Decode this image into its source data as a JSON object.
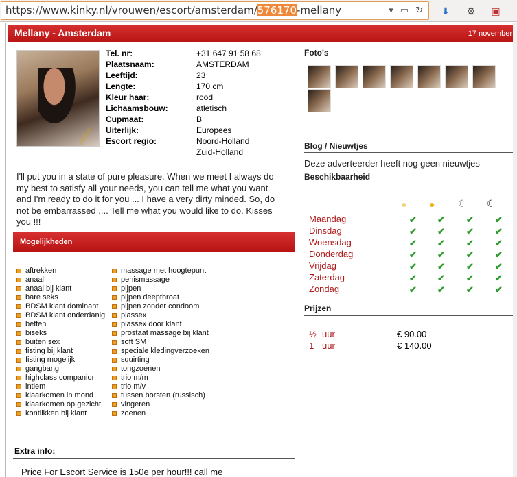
{
  "browser": {
    "url_prefix": "https://www.kinky.nl/vrouwen/escort/amsterdam/",
    "url_highlight": "576170",
    "url_suffix": "-mellany"
  },
  "header": {
    "title": "Mellany - Amsterdam",
    "date": "17 november"
  },
  "profile": {
    "rows": [
      {
        "label": "Tel. nr:",
        "value": "+31 647 91 58 68"
      },
      {
        "label": "Plaatsnaam:",
        "value": "AMSTERDAM"
      },
      {
        "label": "Leeftijd:",
        "value": "23"
      },
      {
        "label": "Lengte:",
        "value": "170 cm"
      },
      {
        "label": "Kleur haar:",
        "value": "rood"
      },
      {
        "label": "Lichaamsbouw:",
        "value": "atletisch"
      },
      {
        "label": "Cupmaat:",
        "value": "B"
      },
      {
        "label": "Uiterlijk:",
        "value": "Europees"
      },
      {
        "label": "Escort regio:",
        "value": "Noord-Holland"
      },
      {
        "label": "",
        "value": "Zuid-Holland"
      }
    ],
    "description": "I'll put you in a state of pure pleasure. When we meet I always do my best to satisfy all your needs, you can tell me what you want and I'm ready to do it for you ... I have a very dirty minded. So, do not be embarrassed .... Tell me what you would like to do. Kisses you !!!"
  },
  "mogelijkheden": {
    "title": "Mogelijkheden",
    "col1": [
      "aftrekken",
      "anaal",
      "anaal bij klant",
      "bare seks",
      "BDSM klant dominant",
      "BDSM klant onderdanig",
      "beffen",
      "biseks",
      "buiten sex",
      "fisting bij klant",
      "fisting mogelijk",
      "gangbang",
      "highclass companion",
      "intiem",
      "klaarkomen in mond",
      "klaarkomen op gezicht",
      "kontlikken bij klant"
    ],
    "col2": [
      "massage met hoogtepunt",
      "penismassage",
      "pijpen",
      "pijpen deepthroat",
      "pijpen zonder condoom",
      "plassex",
      "plassex door klant",
      "prostaat massage bij klant",
      "soft SM",
      "speciale kledingverzoeken",
      "squirting",
      "tongzoenen",
      "trio m/m",
      "trio m/v",
      "tussen borsten (russisch)",
      "vingeren",
      "zoenen"
    ]
  },
  "extra": {
    "title": "Extra info:",
    "text": "Price For Escort Service is 150e per hour!!! call me"
  },
  "right": {
    "photos_title": "Foto's",
    "blog_title": "Blog / Nieuwtjes",
    "blog_text": "Deze adverteerder heeft nog geen nieuwtjes",
    "avail_title": "Beschikbaarheid",
    "days": [
      "Maandag",
      "Dinsdag",
      "Woensdag",
      "Donderdag",
      "Vrijdag",
      "Zaterdag",
      "Zondag"
    ],
    "prices_title": "Prijzen",
    "prices": [
      {
        "qty": "½",
        "unit": "uur",
        "price": "€ 90.00"
      },
      {
        "qty": "1",
        "unit": "uur",
        "price": "€ 140.00"
      }
    ]
  },
  "icons": {
    "check": "check-icon",
    "morning": "sun-pale-icon",
    "afternoon": "sun-icon",
    "evening": "moon-icon",
    "night": "moon-dark-icon"
  }
}
